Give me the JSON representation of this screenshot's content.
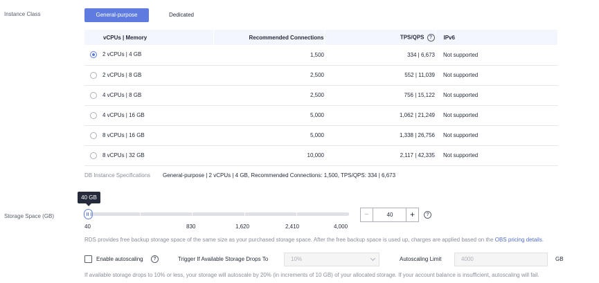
{
  "instance_class": {
    "label": "Instance Class",
    "options": [
      "General-purpose",
      "Dedicated"
    ],
    "selected": "General-purpose"
  },
  "spec_table": {
    "headers": [
      "vCPUs | Memory",
      "Recommended Connections",
      "TPS/QPS",
      "IPv6"
    ],
    "tps_help_icon": "help-icon",
    "rows": [
      {
        "spec": "2 vCPUs | 4 GB",
        "connections": "1,500",
        "tps": "334 | 6,673",
        "ipv6": "Not supported",
        "selected": true
      },
      {
        "spec": "2 vCPUs | 8 GB",
        "connections": "2,500",
        "tps": "552 | 11,039",
        "ipv6": "Not supported",
        "selected": false
      },
      {
        "spec": "4 vCPUs | 8 GB",
        "connections": "2,500",
        "tps": "756 | 15,122",
        "ipv6": "Not supported",
        "selected": false
      },
      {
        "spec": "4 vCPUs | 16 GB",
        "connections": "5,000",
        "tps": "1,062 | 21,249",
        "ipv6": "Not supported",
        "selected": false
      },
      {
        "spec": "8 vCPUs | 16 GB",
        "connections": "5,000",
        "tps": "1,338 | 26,756",
        "ipv6": "Not supported",
        "selected": false
      },
      {
        "spec": "8 vCPUs | 32 GB",
        "connections": "10,000",
        "tps": "2,117 | 42,335",
        "ipv6": "Not supported",
        "selected": false
      }
    ]
  },
  "db_spec": {
    "label": "DB Instance Specifications",
    "value": "General-purpose | 2 vCPUs | 4 GB, Recommended Connections: 1,500, TPS/QPS: 334 | 6,673"
  },
  "storage": {
    "label": "Storage Space (GB)",
    "tooltip": "40 GB",
    "ticks": [
      "40",
      "830",
      "1,620",
      "2,410",
      "4,000"
    ],
    "min": 40,
    "max": 4000,
    "value": "40",
    "minus": "−",
    "plus": "+",
    "note_text": "RDS provides free backup storage space of the same size as your purchased storage space. After the free backup space is used up, charges are applied based on the ",
    "note_link": "OBS pricing details",
    "note_end": "."
  },
  "autoscaling": {
    "checkbox_label": "Enable autoscaling",
    "checked": false,
    "trigger_label": "Trigger If Available Storage Drops To",
    "trigger_value": "10%",
    "limit_label": "Autoscaling Limit",
    "limit_placeholder": "4000",
    "unit": "GB",
    "note": "If available storage drops to 10% or less, your storage will autoscale by 20% (in increments of 10 GB) of your allocated storage. If your account balance is insufficient, autoscaling will fail."
  },
  "colors": {
    "accent": "#5e7ce0",
    "link": "#526ecc",
    "text": "#252b3a",
    "muted": "#8a8e99"
  }
}
